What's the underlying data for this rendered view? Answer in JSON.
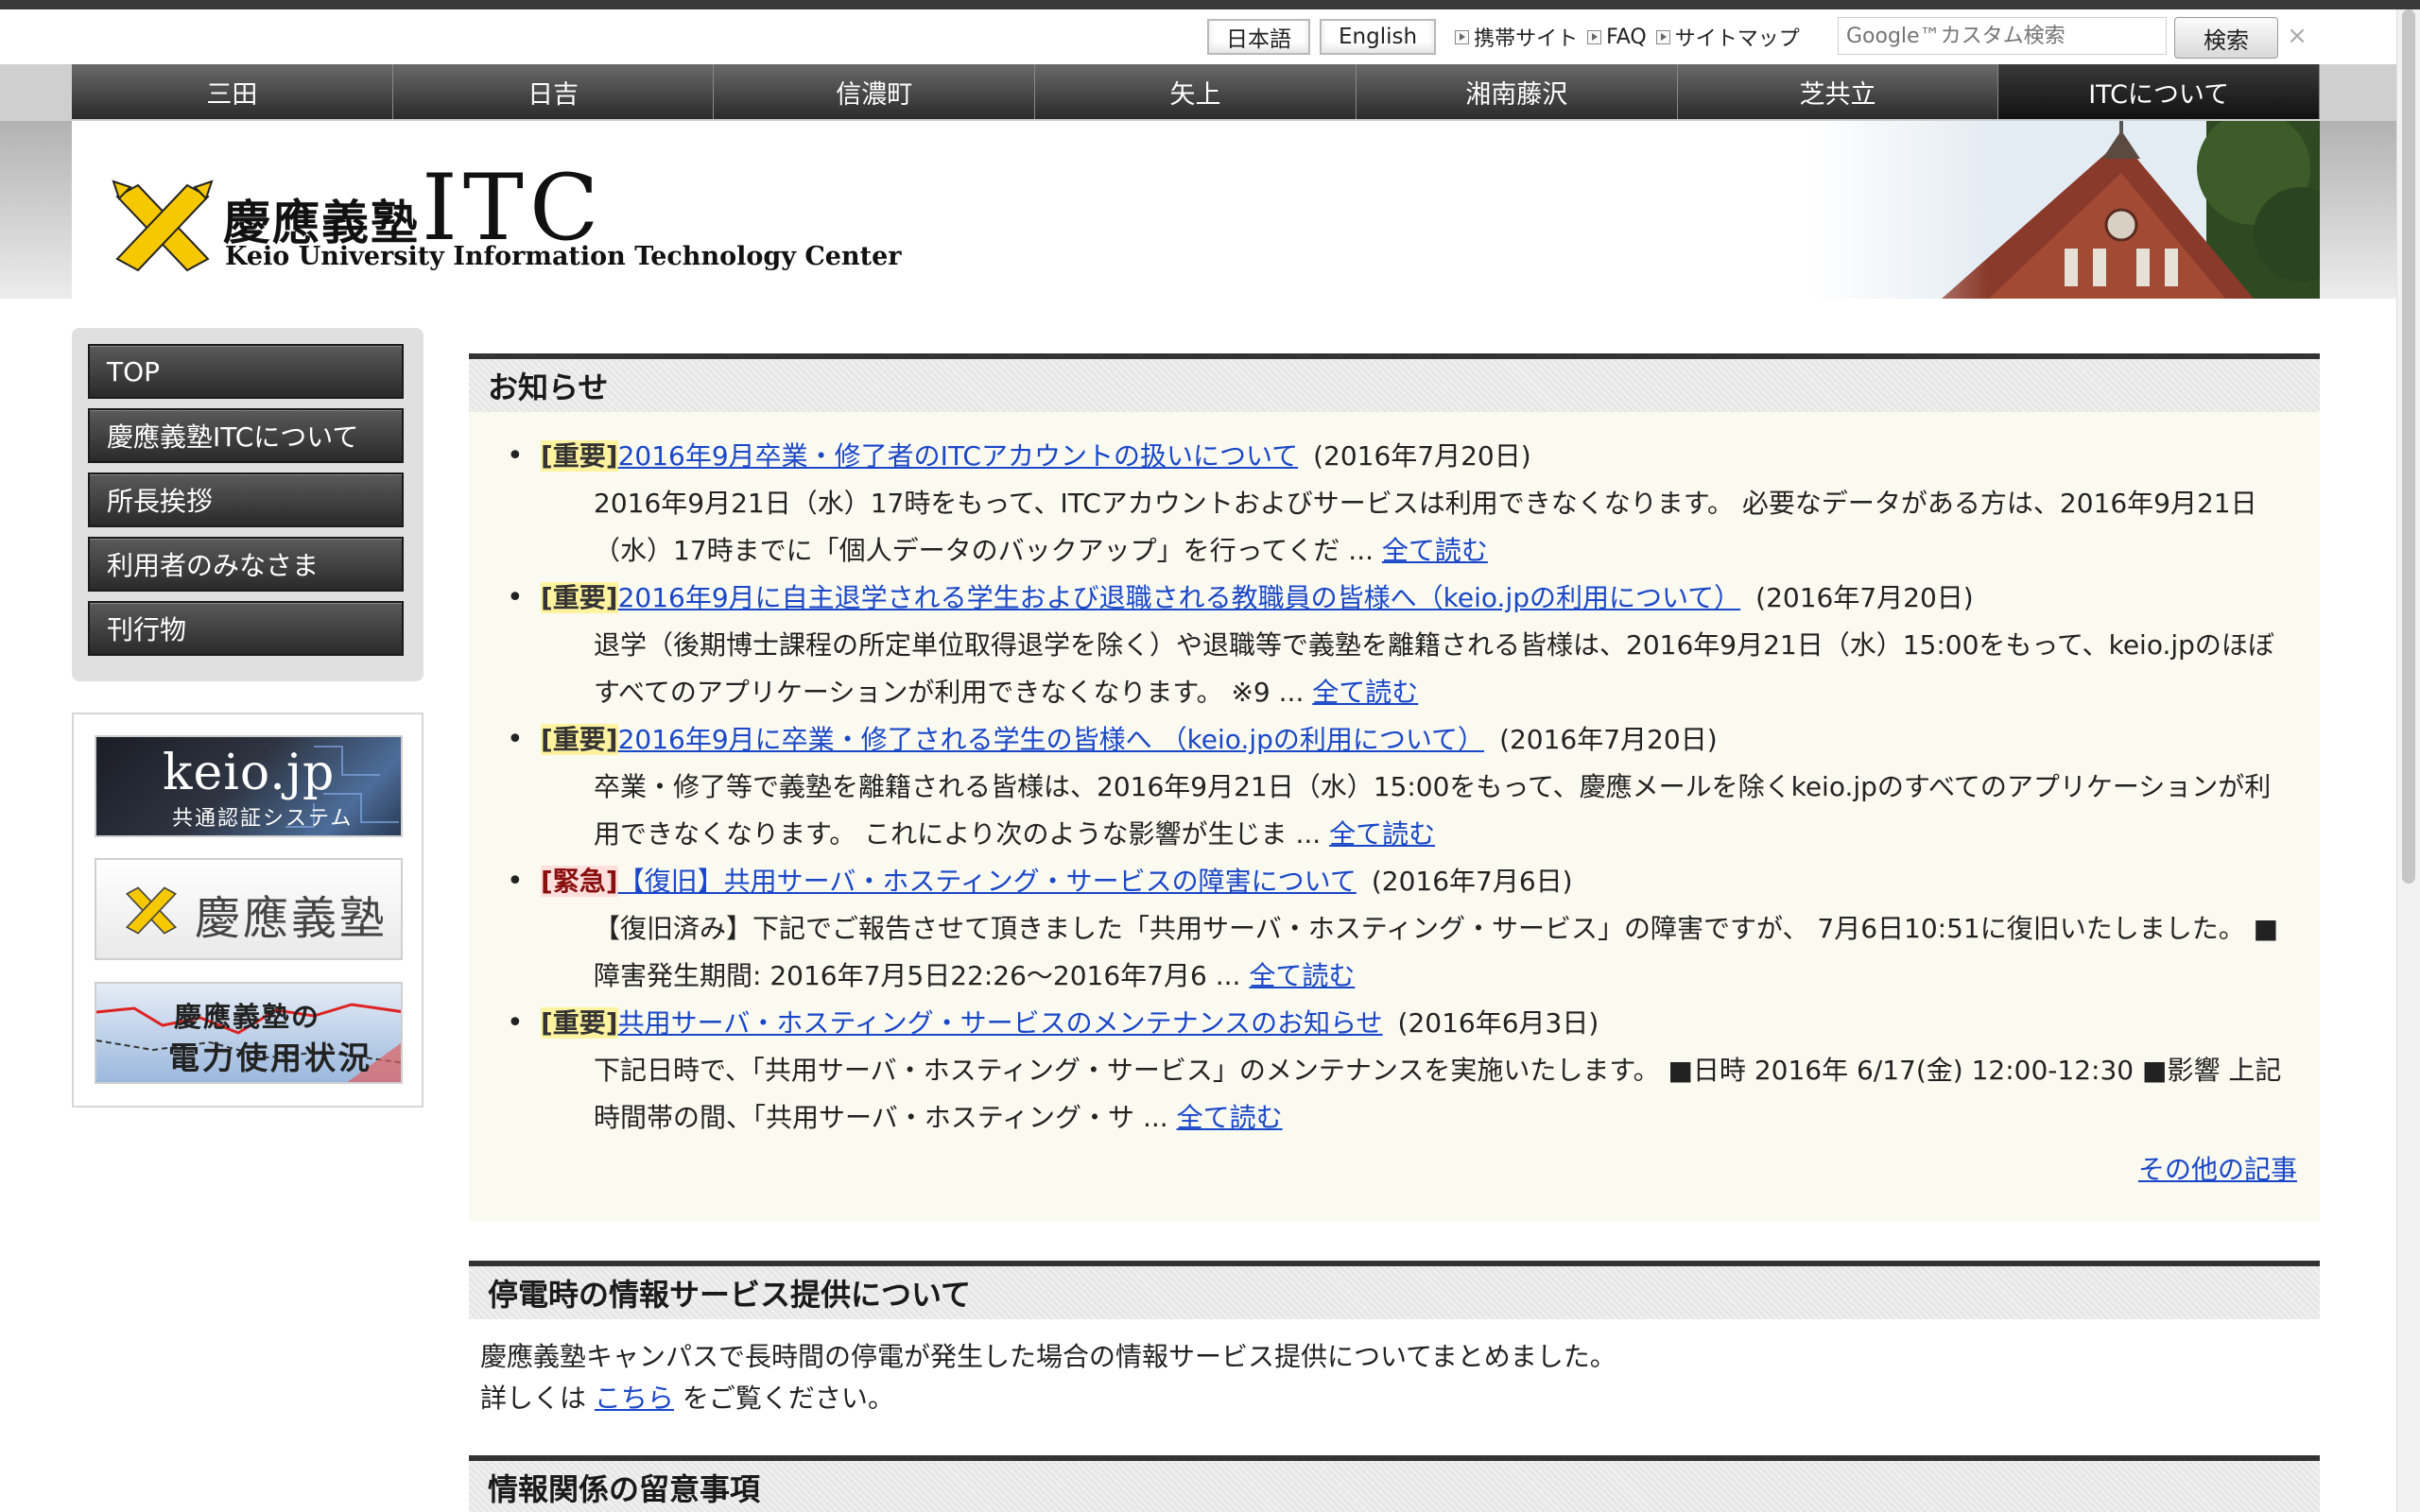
{
  "utility": {
    "lang_ja": "日本語",
    "lang_en": "English",
    "links": [
      "携帯サイト",
      "FAQ",
      "サイトマップ"
    ],
    "search_placeholder": "Google™カスタム検索",
    "search_button": "検索"
  },
  "global_nav": [
    "三田",
    "日吉",
    "信濃町",
    "矢上",
    "湘南藤沢",
    "芝共立",
    "ITCについて"
  ],
  "header": {
    "logo_jp": "慶應義塾",
    "logo_itc": "ITC",
    "logo_en": "Keio University Information Technology Center"
  },
  "side_nav": [
    "TOP",
    "慶應義塾ITCについて",
    "所長挨拶",
    "利用者のみなさま",
    "刊行物"
  ],
  "banners": {
    "keio_jp": "keio.jp",
    "keio_jp_sub": "共通認証システム",
    "keio": "慶應義塾",
    "power_line1": "慶應義塾の",
    "power_line2": "電力使用状況"
  },
  "news": {
    "heading": "お知らせ",
    "items": [
      {
        "tag": "[重要]",
        "title": "2016年9月卒業・修了者のITCアカウントの扱いについて",
        "date": "(2016年7月20日)",
        "summary": "2016年9月21日（水）17時をもって、ITCアカウントおよびサービスは利用できなくなります。 必要なデータがある方は、2016年9月21日（水）17時までに「個人データのバックアップ」を行ってくだ ...",
        "more": "全て読む"
      },
      {
        "tag": "[重要]",
        "title": "2016年9月に自主退学される学生および退職される教職員の皆様へ（keio.jpの利用について）",
        "date": "(2016年7月20日)",
        "summary": "退学（後期博士課程の所定単位取得退学を除く）や退職等で義塾を離籍される皆様は、2016年9月21日（水）15:00をもって、keio.jpのほぼすべてのアプリケーションが利用できなくなります。 ※9 ...",
        "more": "全て読む"
      },
      {
        "tag": "[重要]",
        "title": "2016年9月に卒業・修了される学生の皆様へ （keio.jpの利用について）",
        "date": "(2016年7月20日)",
        "summary": "卒業・修了等で義塾を離籍される皆様は、2016年9月21日（水）15:00をもって、慶應メールを除くkeio.jpのすべてのアプリケーションが利用できなくなります。 これにより次のような影響が生じま ...",
        "more": "全て読む"
      },
      {
        "tag": "[緊急]",
        "title": "【復旧】共用サーバ・ホスティング・サービスの障害について",
        "date": "(2016年7月6日)",
        "summary": "【復旧済み】下記でご報告させて頂きました「共用サーバ・ホスティング・サービス」の障害ですが、 7月6日10:51に復旧いたしました。 ■障害発生期間: 2016年7月5日22:26〜2016年7月6 ...",
        "more": "全て読む"
      },
      {
        "tag": "[重要]",
        "title": "共用サーバ・ホスティング・サービスのメンテナンスのお知らせ",
        "date": "(2016年6月3日)",
        "summary": "下記日時で、「共用サーバ・ホスティング・サービス」のメンテナンスを実施いたします。 ■日時 2016年 6/17(金) 12:00-12:30 ■影響 上記時間帯の間、「共用サーバ・ホスティング・サ ...",
        "more": "全て読む"
      }
    ],
    "others": "その他の記事"
  },
  "outage": {
    "heading": "停電時の情報サービス提供について",
    "line1": "慶應義塾キャンパスで長時間の停電が発生した場合の情報サービス提供についてまとめました。",
    "line2_pre": "詳しくは",
    "line2_link": "こちら",
    "line2_post": "をご覧ください。"
  },
  "notes": {
    "heading": "情報関係の留意事項"
  }
}
